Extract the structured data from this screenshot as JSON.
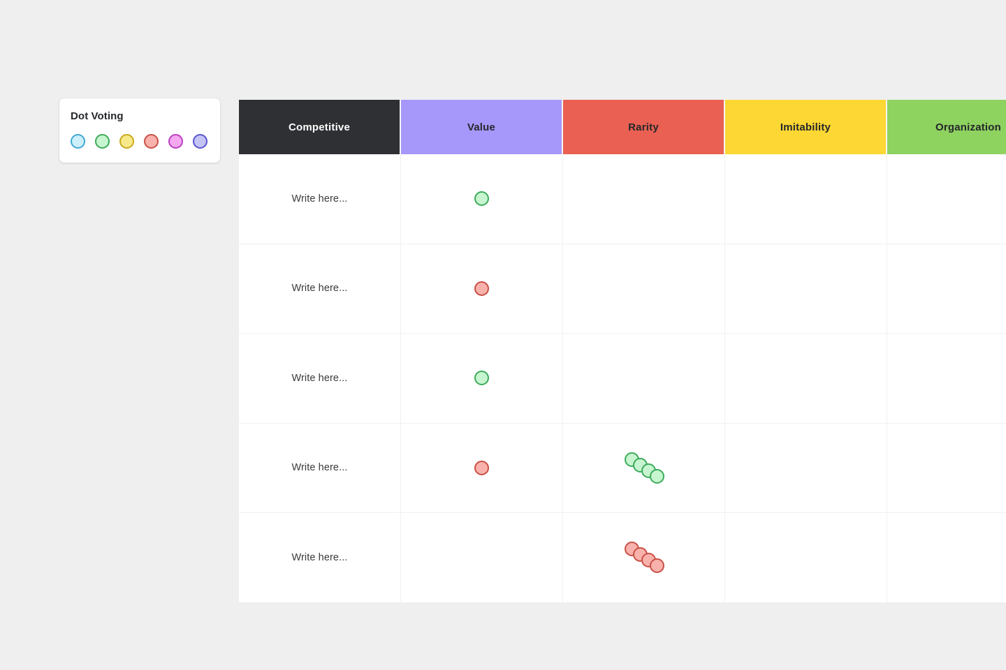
{
  "canvas": {
    "background": "#efefef"
  },
  "dot_voting_panel": {
    "title": "Dot Voting",
    "swatches": [
      {
        "name": "blue",
        "fill": "#cdeefb",
        "border": "#3fa9d4"
      },
      {
        "name": "green",
        "fill": "#c6f5d0",
        "border": "#3cab5a"
      },
      {
        "name": "yellow",
        "fill": "#f7e98a",
        "border": "#c9a81c"
      },
      {
        "name": "red",
        "fill": "#f8b2ab",
        "border": "#c94f46"
      },
      {
        "name": "magenta",
        "fill": "#f3a8f0",
        "border": "#bd3fc0"
      },
      {
        "name": "purple",
        "fill": "#c3c3f6",
        "border": "#5a53cf"
      }
    ]
  },
  "matrix": {
    "columns": [
      {
        "label": "Competitive",
        "bg": "#2e3033",
        "fg": "#ffffff"
      },
      {
        "label": "Value",
        "bg": "#a698fb",
        "fg": "#25272b"
      },
      {
        "label": "Rarity",
        "bg": "#ea6052",
        "fg": "#25272b"
      },
      {
        "label": "Imitability",
        "bg": "#fdd734",
        "fg": "#25272b"
      },
      {
        "label": "Organization",
        "bg": "#8ed260",
        "fg": "#25272b"
      }
    ],
    "rows": [
      {
        "competitive": "Write here...",
        "value_dots": [
          {
            "color": "green"
          }
        ],
        "rarity_dots": [],
        "imitability_dots": [],
        "organization_dots": []
      },
      {
        "competitive": "Write here...",
        "value_dots": [
          {
            "color": "red"
          }
        ],
        "rarity_dots": [],
        "imitability_dots": [],
        "organization_dots": []
      },
      {
        "competitive": "Write here...",
        "value_dots": [
          {
            "color": "green"
          }
        ],
        "rarity_dots": [],
        "imitability_dots": [],
        "organization_dots": []
      },
      {
        "competitive": "Write here...",
        "value_dots": [
          {
            "color": "red"
          }
        ],
        "rarity_dots": [
          {
            "color": "green",
            "x": 0,
            "y": 0
          },
          {
            "color": "green",
            "x": 12,
            "y": 8
          },
          {
            "color": "green",
            "x": 24,
            "y": 16
          },
          {
            "color": "green",
            "x": 36,
            "y": 24
          }
        ],
        "imitability_dots": [],
        "organization_dots": []
      },
      {
        "competitive": "Write here...",
        "value_dots": [],
        "rarity_dots": [
          {
            "color": "red",
            "x": 0,
            "y": 0
          },
          {
            "color": "red",
            "x": 12,
            "y": 8
          },
          {
            "color": "red",
            "x": 24,
            "y": 16
          },
          {
            "color": "red",
            "x": 36,
            "y": 24
          }
        ],
        "imitability_dots": [],
        "organization_dots": []
      }
    ]
  },
  "dot_colors": {
    "green": {
      "fill": "#c6f5d0",
      "border": "#3cab5a"
    },
    "red": {
      "fill": "#f8b2ab",
      "border": "#c94f46"
    }
  }
}
